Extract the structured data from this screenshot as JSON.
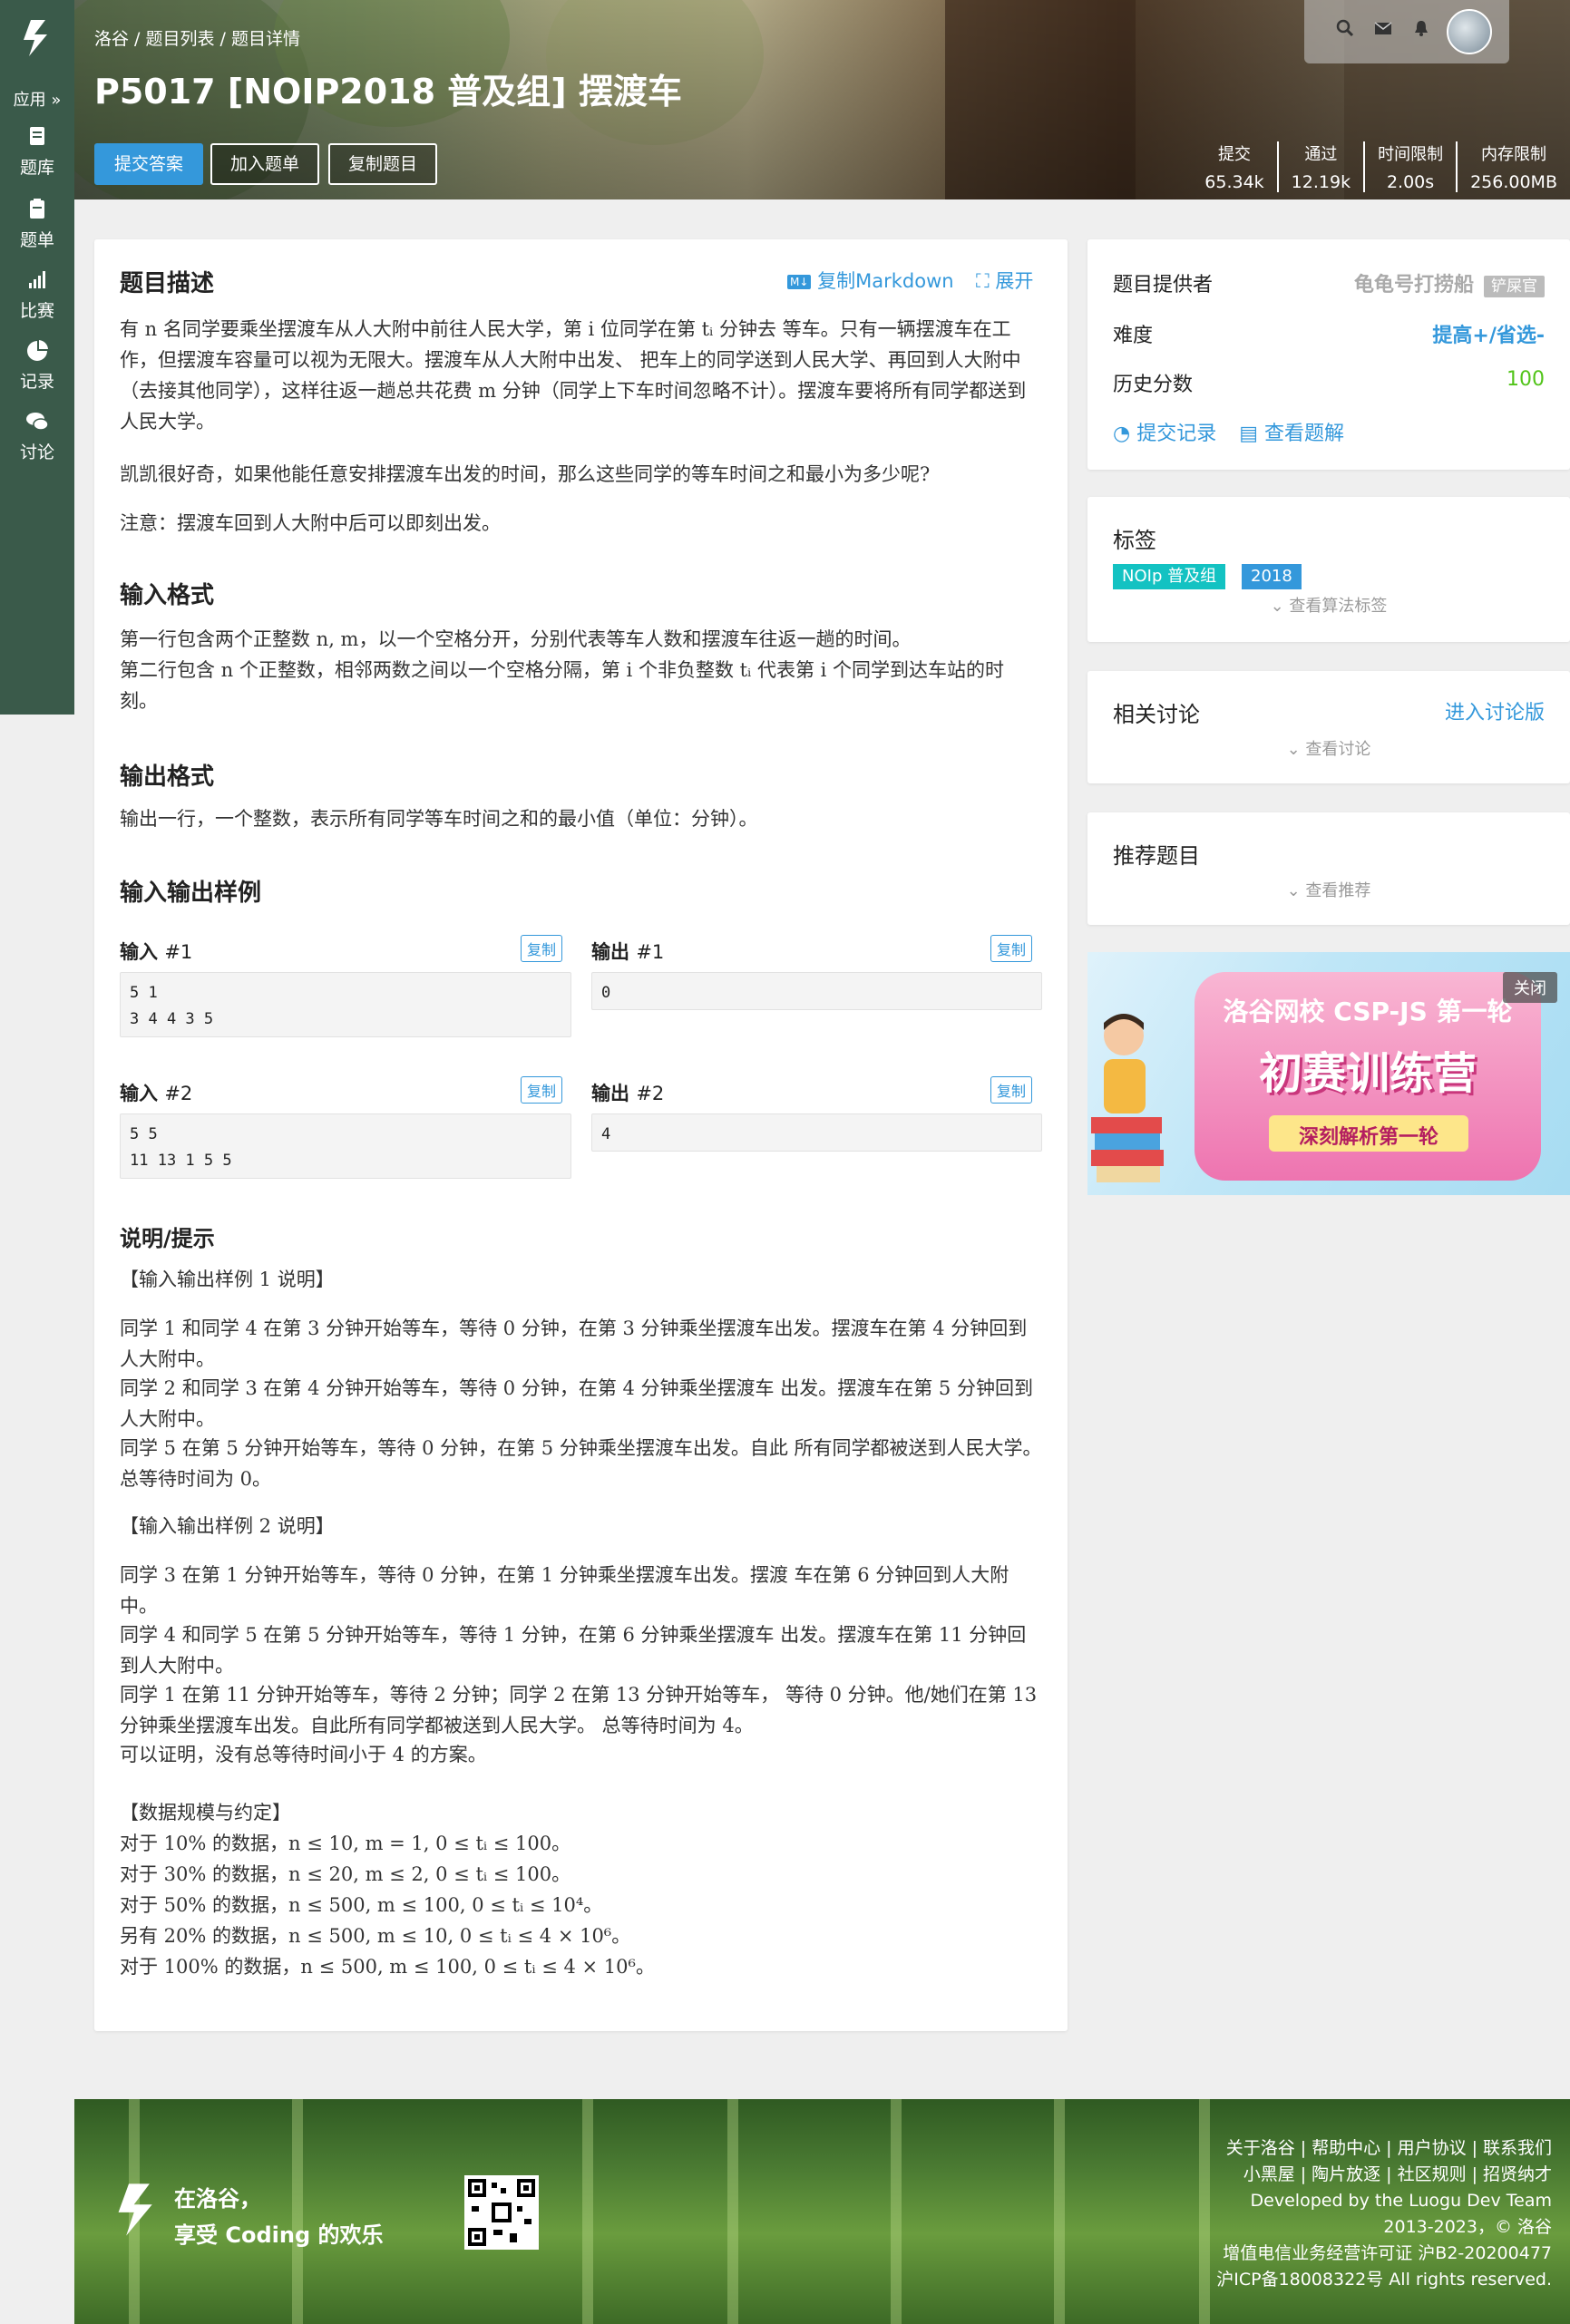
{
  "sidebar": {
    "app": "应用 »",
    "items": [
      {
        "label": "题库",
        "icon": "problemset-icon"
      },
      {
        "label": "题单",
        "icon": "training-icon"
      },
      {
        "label": "比赛",
        "icon": "contest-icon"
      },
      {
        "label": "记录",
        "icon": "record-icon"
      },
      {
        "label": "讨论",
        "icon": "discuss-icon"
      }
    ]
  },
  "header": {
    "breadcrumb": [
      "洛谷",
      "题目列表",
      "题目详情"
    ],
    "title": "P5017 [NOIP2018 普及组] 摆渡车",
    "buttons": {
      "submit": "提交答案",
      "add_list": "加入题单",
      "copy_problem": "复制题目"
    },
    "stats": [
      {
        "label": "提交",
        "value": "65.34k"
      },
      {
        "label": "通过",
        "value": "12.19k"
      },
      {
        "label": "时间限制",
        "value": "2.00s"
      },
      {
        "label": "内存限制",
        "value": "256.00MB"
      }
    ]
  },
  "main": {
    "desc_title": "题目描述",
    "copy_markdown": "复制Markdown",
    "expand": "展开",
    "desc_p1": "有 n 名同学要乘坐摆渡车从人大附中前往人民大学，第 i 位同学在第 tᵢ 分钟去 等车。只有一辆摆渡车在工作，但摆渡车容量可以视为无限大。摆渡车从人大附中出发、 把车上的同学送到人民大学、再回到人大附中（去接其他同学），这样往返一趟总共花费 m 分钟（同学上下车时间忽略不计）。摆渡车要将所有同学都送到人民大学。",
    "desc_p2": "凯凯很好奇，如果他能任意安排摆渡车出发的时间，那么这些同学的等车时间之和最小为多少呢?",
    "desc_p3": "注意：摆渡车回到人大附中后可以即刻出发。",
    "input_title": "输入格式",
    "input_p": "第一行包含两个正整数 n, m，以一个空格分开，分别代表等车人数和摆渡车往返一趟的时间。",
    "input_p2": "第二行包含 n 个正整数，相邻两数之间以一个空格分隔，第 i 个非负整数 tᵢ 代表第 i 个同学到达车站的时刻。",
    "output_title": "输出格式",
    "output_p": "输出一行，一个整数，表示所有同学等车时间之和的最小值（单位：分钟）。",
    "samples_title": "输入输出样例",
    "copy_label": "复制",
    "samples": [
      {
        "in_label": "输入",
        "out_label": "输出",
        "idx": "#1",
        "input": "5 1\n3 4 4 3 5",
        "output": "0"
      },
      {
        "in_label": "输入",
        "out_label": "输出",
        "idx": "#2",
        "input": "5 5\n11 13 1 5 5",
        "output": "4"
      }
    ],
    "hint_title": "说明/提示",
    "hint_s1_title": "【输入输出样例 1 说明】",
    "hint_s1": [
      "同学 1 和同学 4 在第 3 分钟开始等车，等待 0 分钟，在第 3 分钟乘坐摆渡车出发。摆渡车在第 4 分钟回到人大附中。",
      "同学 2 和同学 3 在第 4 分钟开始等车，等待 0 分钟，在第 4 分钟乘坐摆渡车 出发。摆渡车在第 5 分钟回到人大附中。",
      "同学 5 在第 5 分钟开始等车，等待 0 分钟，在第 5 分钟乘坐摆渡车出发。自此 所有同学都被送到人民大学。总等待时间为 0。"
    ],
    "hint_s2_title": "【输入输出样例 2 说明】",
    "hint_s2": [
      "同学 3 在第 1 分钟开始等车，等待 0 分钟，在第 1 分钟乘坐摆渡车出发。摆渡 车在第 6 分钟回到人大附中。",
      "同学 4 和同学 5 在第 5 分钟开始等车，等待 1 分钟，在第 6 分钟乘坐摆渡车 出发。摆渡车在第 11 分钟回到人大附中。",
      "同学 1 在第 11 分钟开始等车，等待 2 分钟；同学 2 在第 13 分钟开始等车， 等待 0 分钟。他/她们在第 13 分钟乘坐摆渡车出发。自此所有同学都被送到人民大学。 总等待时间为 4。",
      "可以证明，没有总等待时间小于 4 的方案。"
    ],
    "hint_s3_title": "【数据规模与约定】",
    "hint_s3": [
      "对于 10% 的数据，n ≤ 10, m = 1, 0 ≤ tᵢ ≤ 100。",
      "对于 30% 的数据，n ≤ 20, m ≤ 2, 0 ≤ tᵢ ≤ 100。",
      "对于 50% 的数据，n ≤ 500, m ≤ 100, 0 ≤ tᵢ ≤ 10⁴。",
      "另有 20% 的数据，n ≤ 500, m ≤ 10, 0 ≤ tᵢ ≤ 4 × 10⁶。",
      "对于 100% 的数据，n ≤ 500, m ≤ 100, 0 ≤ tᵢ ≤ 4 × 10⁶。"
    ]
  },
  "side": {
    "provider_label": "题目提供者",
    "provider_name": "龟龟号打捞船",
    "provider_badge": "铲屎官",
    "difficulty_label": "难度",
    "difficulty_value": "提高+/省选-",
    "score_label": "历史分数",
    "score_value": "100",
    "records_link": "提交记录",
    "solutions_link": "查看题解",
    "tags_title": "标签",
    "tags": [
      "NOIp 普及组",
      "2018"
    ],
    "show_algo_tags": "查看算法标签",
    "discuss_title": "相关讨论",
    "discuss_link": "进入讨论版",
    "show_discuss": "查看讨论",
    "recommend_title": "推荐题目",
    "show_recommend": "查看推荐"
  },
  "ad": {
    "line1": "洛谷网校 CSP-JS 第一轮",
    "line2": "初赛训练营",
    "line3": "深刻解析第一轮",
    "close": "关闭"
  },
  "footer": {
    "slogan_1": "在洛谷，",
    "slogan_2": "享受 Coding 的欢乐",
    "links_row1": [
      "关于洛谷",
      "帮助中心",
      "用户协议",
      "联系我们"
    ],
    "links_row2": [
      "小黑屋",
      "陶片放逐",
      "社区规则",
      "招贤纳才"
    ],
    "dev_team": "Developed by the Luogu Dev Team",
    "copyright": "2013-2023，© 洛谷",
    "license": "增值电信业务经营许可证 沪B2-20200477",
    "icp": "沪ICP备18008322号 All rights reserved."
  },
  "colors": {
    "sidebar": "#3a5a4a",
    "accent": "#3498db",
    "tag_noip": "#13c2c2",
    "tag_year": "#3498db",
    "score": "#52c41a"
  }
}
